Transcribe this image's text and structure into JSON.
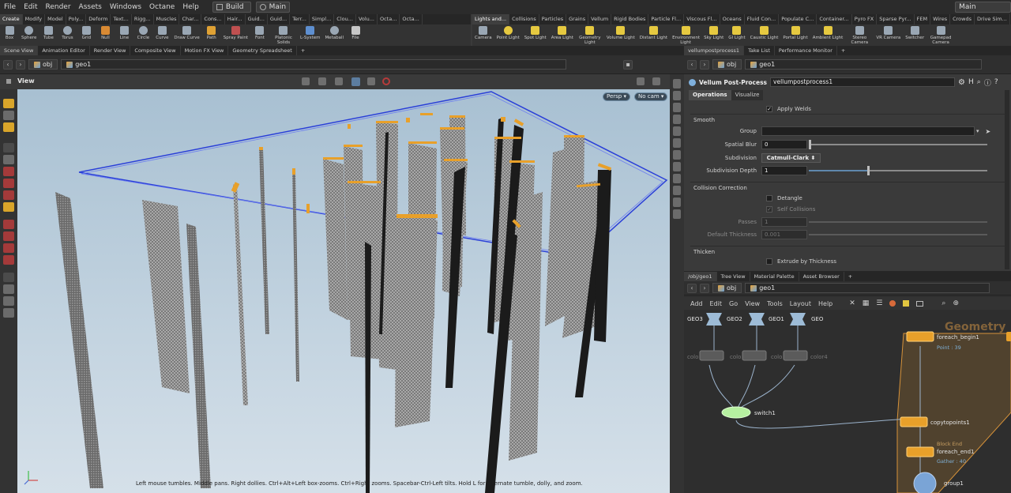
{
  "menubar": {
    "items": [
      "File",
      "Edit",
      "Render",
      "Assets",
      "Windows",
      "Octane",
      "Help"
    ],
    "desktop": "Build",
    "context": "Main",
    "right_context": "Main"
  },
  "shelf_left": {
    "tabs": [
      "Create",
      "Modify",
      "Model",
      "Poly...",
      "Deform",
      "Text...",
      "Rigg...",
      "Muscles",
      "Char...",
      "Cons...",
      "Hair...",
      "Guid...",
      "Guid...",
      "Terr...",
      "Simpl...",
      "Clou...",
      "Volu...",
      "Octa...",
      "Octa..."
    ],
    "tools": [
      "Box",
      "Sphere",
      "Tube",
      "Torus",
      "Grid",
      "Null",
      "Line",
      "Circle",
      "Curve",
      "Draw Curve",
      "Path",
      "Spray Paint",
      "Font",
      "Platonic Solids",
      "L-System",
      "Metaball",
      "File"
    ]
  },
  "shelf_right": {
    "tabs": [
      "Lights and...",
      "Collisions",
      "Particles",
      "Grains",
      "Vellum",
      "Rigid Bodies",
      "Particle Fl...",
      "Viscous Fl...",
      "Oceans",
      "Fluid Con...",
      "Populate C...",
      "Container...",
      "Pyro FX",
      "Sparse Pyr...",
      "FEM",
      "Wires",
      "Crowds",
      "Drive Sim..."
    ],
    "tools": [
      "Camera",
      "Point Light",
      "Spot Light",
      "Area Light",
      "Geometry Light",
      "Volume Light",
      "Distant Light",
      "Environment Light",
      "Sky Light",
      "GI Light",
      "Caustic Light",
      "Portal Light",
      "Ambient Light",
      "Stereo Camera",
      "VR Camera",
      "Switcher",
      "Gamepad Camera"
    ]
  },
  "left_pane": {
    "tabs": [
      "Scene View",
      "Animation Editor",
      "Render View",
      "Composite View",
      "Motion FX View",
      "Geometry Spreadsheet"
    ],
    "path": [
      "obj",
      "geo1"
    ],
    "view_label": "View",
    "persp": "Persp",
    "cam": "No cam",
    "status": "Left mouse tumbles. Middle pans. Right dollies. Ctrl+Alt+Left box-zooms. Ctrl+Right zooms. Spacebar-Ctrl-Left tilts. Hold L for alternate tumble, dolly, and zoom."
  },
  "params_pane": {
    "tabs": [
      "vellumpostprocess1",
      "Take List",
      "Performance Monitor"
    ],
    "path": [
      "obj",
      "geo1"
    ],
    "node_type": "Vellum Post-Process",
    "node_name": "vellumpostprocess1",
    "subtabs": [
      "Operations",
      "Visualize"
    ],
    "apply_welds": "Apply Welds",
    "smooth_header": "Smooth",
    "group_label": "Group",
    "spatial_blur_label": "Spatial Blur",
    "spatial_blur_value": "0",
    "subdivision_label": "Subdivision",
    "subdivision_value": "Catmull-Clark",
    "subdivision_depth_label": "Subdivision Depth",
    "subdivision_depth_value": "1",
    "collision_header": "Collision Correction",
    "detangle": "Detangle",
    "self_collisions": "Self Collisions",
    "passes_label": "Passes",
    "passes_value": "1",
    "thickness_label": "Default Thickness",
    "thickness_value": "0.001",
    "thicken_header": "Thicken",
    "extrude": "Extrude by Thickness"
  },
  "network_pane": {
    "tabs": [
      "/obj/geo1",
      "Tree View",
      "Material Palette",
      "Asset Browser"
    ],
    "path": [
      "obj",
      "geo1"
    ],
    "menu": [
      "Add",
      "Edit",
      "Go",
      "View",
      "Tools",
      "Layout",
      "Help"
    ],
    "nodes": {
      "geo3": "GEO3",
      "geo2": "GEO2",
      "geo1": "GEO1",
      "geo": "GEO",
      "c1": "colo",
      "c2": "colo",
      "c3": "colo",
      "c4": "color4",
      "switch": "switch1",
      "foreach_begin": "foreach_begin1",
      "foreach_begin_sub": "Point : 39",
      "copy": "copytopoints1",
      "foreach_end": "foreach_end1",
      "foreach_end_sub": "Gather : 40",
      "foreach_end_tag": "Block End",
      "group": "group1",
      "watermark": "Geometry"
    }
  },
  "colors": {
    "accent_orange": "#e8a02a",
    "bbox_blue": "#3a52d8",
    "node_green": "#b6f0a0"
  }
}
